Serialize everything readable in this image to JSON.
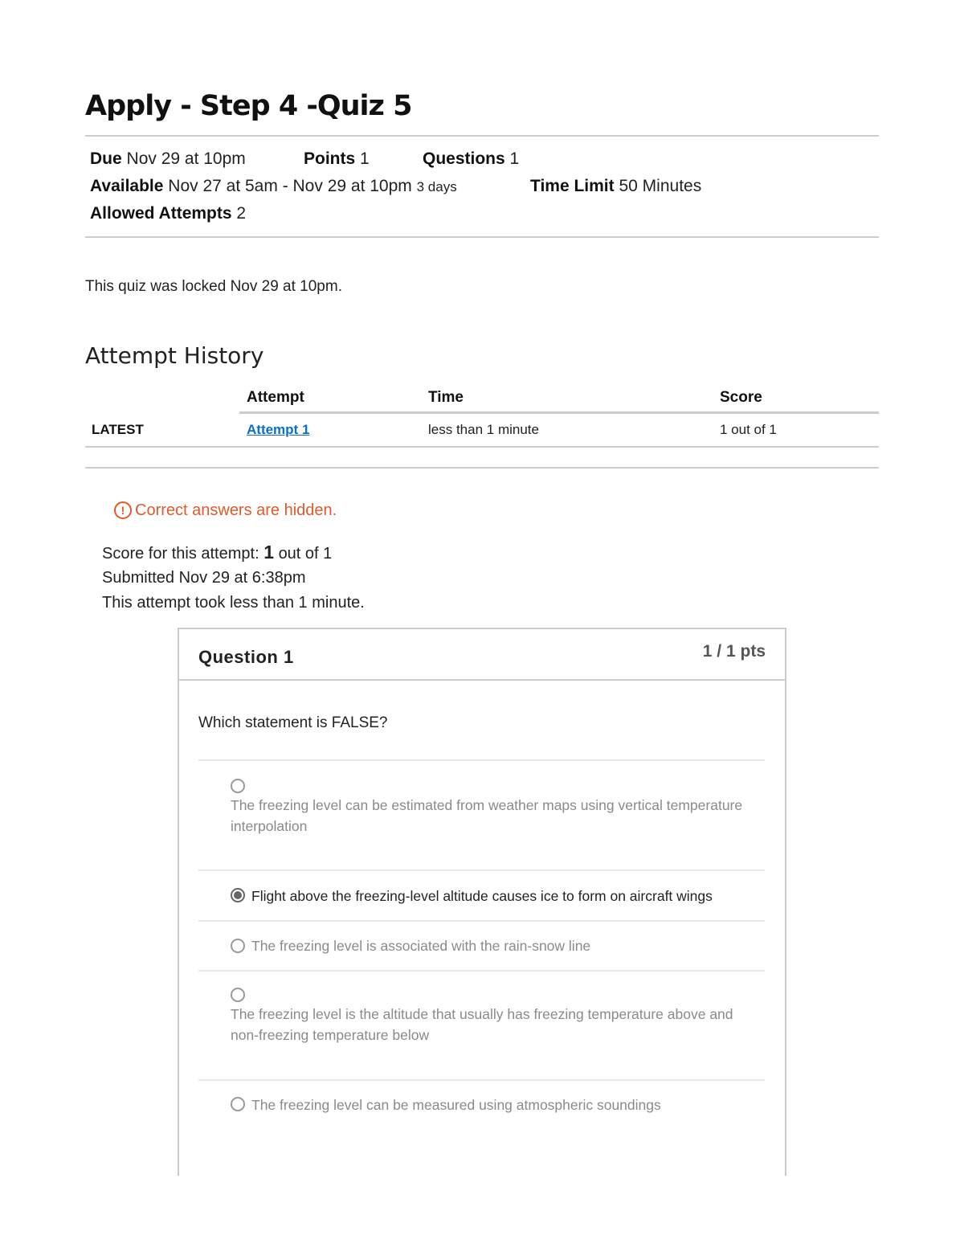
{
  "quiz": {
    "title": "Apply - Step 4 -Quiz 5",
    "due_label": "Due",
    "due_value": "Nov 29 at 10pm",
    "points_label": "Points",
    "points_value": "1",
    "questions_label": "Questions",
    "questions_value": "1",
    "available_label": "Available",
    "available_value": "Nov 27 at 5am - Nov 29 at 10pm",
    "available_duration": "3 days",
    "time_limit_label": "Time Limit",
    "time_limit_value": "50 Minutes",
    "allowed_attempts_label": "Allowed Attempts",
    "allowed_attempts_value": "2",
    "locked_message": "This quiz was locked Nov 29 at 10pm."
  },
  "attempt_history": {
    "heading": "Attempt History",
    "columns": {
      "attempt": "Attempt",
      "time": "Time",
      "score": "Score"
    },
    "rows": [
      {
        "label": "LATEST",
        "attempt": "Attempt 1",
        "time": "less than 1 minute",
        "score": "1 out of 1"
      }
    ]
  },
  "result": {
    "warning_icon": "!",
    "warning": "Correct answers are hidden.",
    "score_prefix": "Score for this attempt:",
    "score_value": "1",
    "score_suffix": "out of 1",
    "submitted": "Submitted Nov 29 at 6:38pm",
    "duration": "This attempt took less than 1 minute."
  },
  "question": {
    "title": "Question 1",
    "points": "1 / 1 pts",
    "text": "Which statement is FALSE?",
    "answers": [
      {
        "text": "The freezing level can be estimated from weather maps using vertical temperature interpolation",
        "selected": false
      },
      {
        "text": "Flight above the freezing-level altitude causes ice to form on aircraft wings",
        "selected": true
      },
      {
        "text": "The freezing level is associated with the rain-snow line",
        "selected": false
      },
      {
        "text": "The freezing level is the altitude that usually has freezing temperature above and non-freezing temperature below",
        "selected": false
      },
      {
        "text": "The freezing level can be measured using atmospheric soundings",
        "selected": false
      }
    ]
  }
}
